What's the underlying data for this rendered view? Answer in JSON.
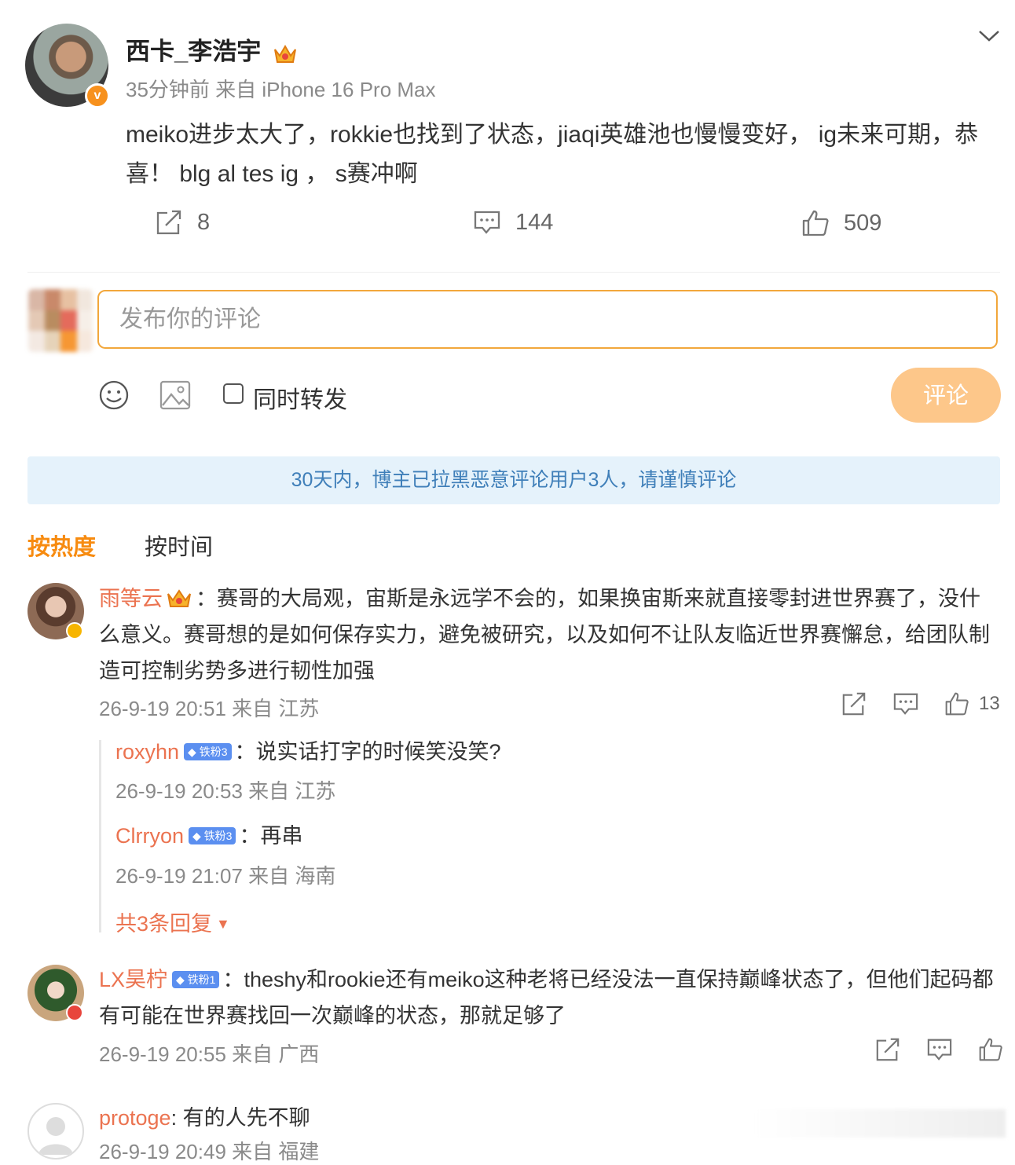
{
  "post": {
    "author": "西卡_李浩宇",
    "meta": "35分钟前 来自 iPhone 16 Pro Max",
    "body": "meiko进步太大了，rokkie也找到了状态，jiaqi英雄池也慢慢变好， ig未来可期，恭喜！ blg al tes ig ， s赛冲啊",
    "reposts": "8",
    "comments": "144",
    "likes": "509"
  },
  "compose": {
    "placeholder": "发布你的评论",
    "also_repost_label": "同时转发",
    "submit_label": "评论"
  },
  "notice": "30天内，博主已拉黑恶意评论用户3人，请谨慎评论",
  "sort": {
    "hot": "按热度",
    "time": "按时间"
  },
  "comments": [
    {
      "user": "雨等云",
      "text": "：赛哥的大局观，宙斯是永远学不会的，如果换宙斯来就直接零封进世界赛了，没什么意义。赛哥想的是如何保存实力，避免被研究，以及如何不让队友临近世界赛懈怠，给团队制造可控制劣势多进行韧性加强",
      "meta": "26-9-19 20:51 来自 江苏",
      "likes": "13",
      "replies": [
        {
          "user": "roxyhn",
          "badge": "铁粉3",
          "text": "：说实话打字的时候笑没笑?",
          "meta": "26-9-19 20:53 来自 江苏"
        },
        {
          "user": "Clrryon",
          "badge": "铁粉3",
          "text": "：再串",
          "meta": "26-9-19 21:07 来自 海南"
        }
      ],
      "more_label": "共3条回复"
    },
    {
      "user": "LX昊柠",
      "badge": "铁粉1",
      "text": "：theshy和rookie还有meiko这种老将已经没法一直保持巅峰状态了，但他们起码都有可能在世界赛找回一次巅峰的状态，那就足够了",
      "meta": "26-9-19 20:55 来自 广西"
    },
    {
      "user": "protoge",
      "text": ": 有的人先不聊",
      "meta": "26-9-19 20:49 来自 福建"
    }
  ],
  "colors": {
    "accent": "#f78b10",
    "username": "#eb7350",
    "notice_text": "#3f7fb9",
    "notice_bg": "#e5f2fb",
    "button": "#fdc78a"
  }
}
